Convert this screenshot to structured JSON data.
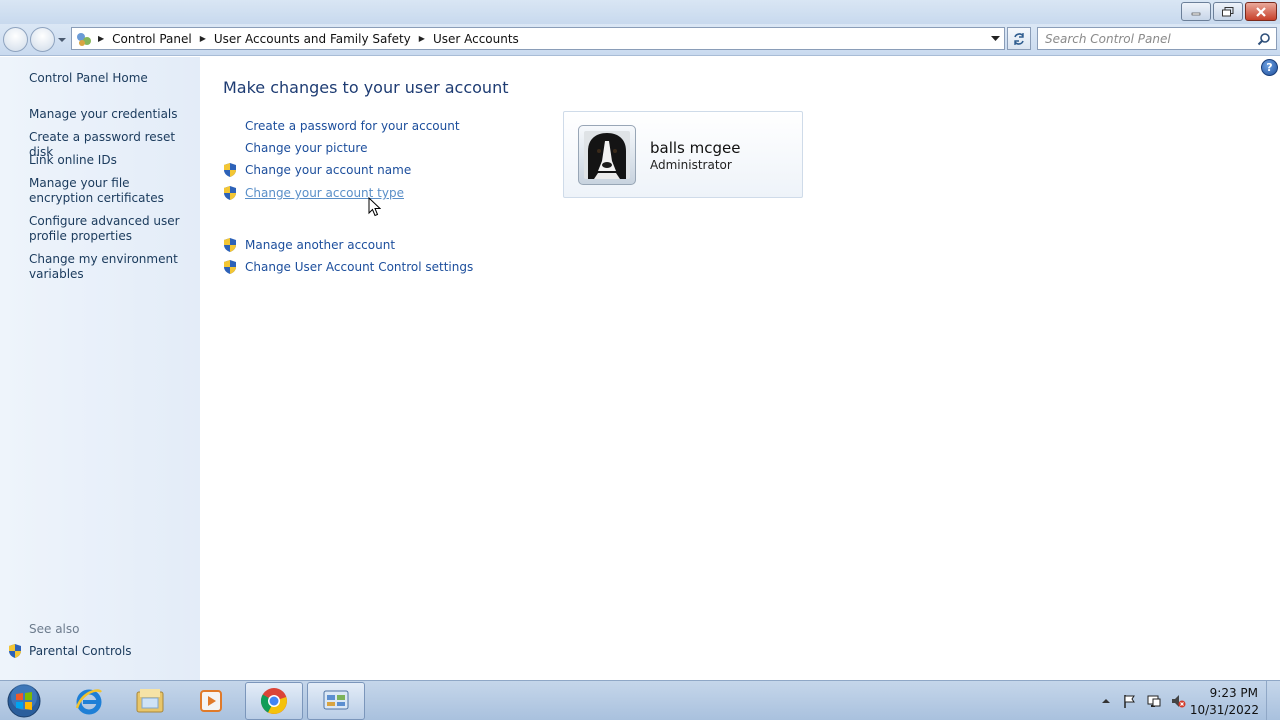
{
  "window": {
    "title": "",
    "controls": {
      "minimize": "minimize-icon",
      "maximize": "restore-icon",
      "close": "close-icon"
    }
  },
  "address": {
    "crumbs": [
      "Control Panel",
      "User Accounts and Family Safety",
      "User Accounts"
    ],
    "search_placeholder": "Search Control Panel"
  },
  "sidebar": {
    "items": [
      "Control Panel Home",
      "Manage your credentials",
      "Create a password reset disk",
      "Link online IDs",
      "Manage your file encryption certificates",
      "Configure advanced user profile properties",
      "Change my environment variables"
    ],
    "see_also_label": "See also",
    "see_also_items": [
      "Parental Controls"
    ]
  },
  "main": {
    "heading": "Make changes to your user account",
    "actions": [
      {
        "label": "Create a password for your account",
        "shield": false
      },
      {
        "label": "Change your picture",
        "shield": false
      },
      {
        "label": "Change your account name",
        "shield": true
      },
      {
        "label": "Change your account type",
        "shield": true
      },
      {
        "label": "Manage another account",
        "shield": true
      },
      {
        "label": "Change User Account Control settings",
        "shield": true
      }
    ]
  },
  "user": {
    "name": "balls mcgee",
    "role": "Administrator"
  },
  "taskbar": {
    "pinned": [
      "start-orb-icon",
      "internet-explorer-icon",
      "windows-explorer-icon",
      "media-player-icon",
      "chrome-icon",
      "control-panel-icon"
    ],
    "clock_time": "9:23 PM",
    "clock_date": "10/31/2022",
    "tray_icons": [
      "show-hidden-icons-icon",
      "action-center-flag-icon",
      "network-icon",
      "volume-muted-icon"
    ]
  },
  "colors": {
    "link": "#1c4e9c",
    "hover_link": "#5a8fc8",
    "heading": "#1e3c73",
    "sidebar_bg": "#e3ecf8"
  }
}
